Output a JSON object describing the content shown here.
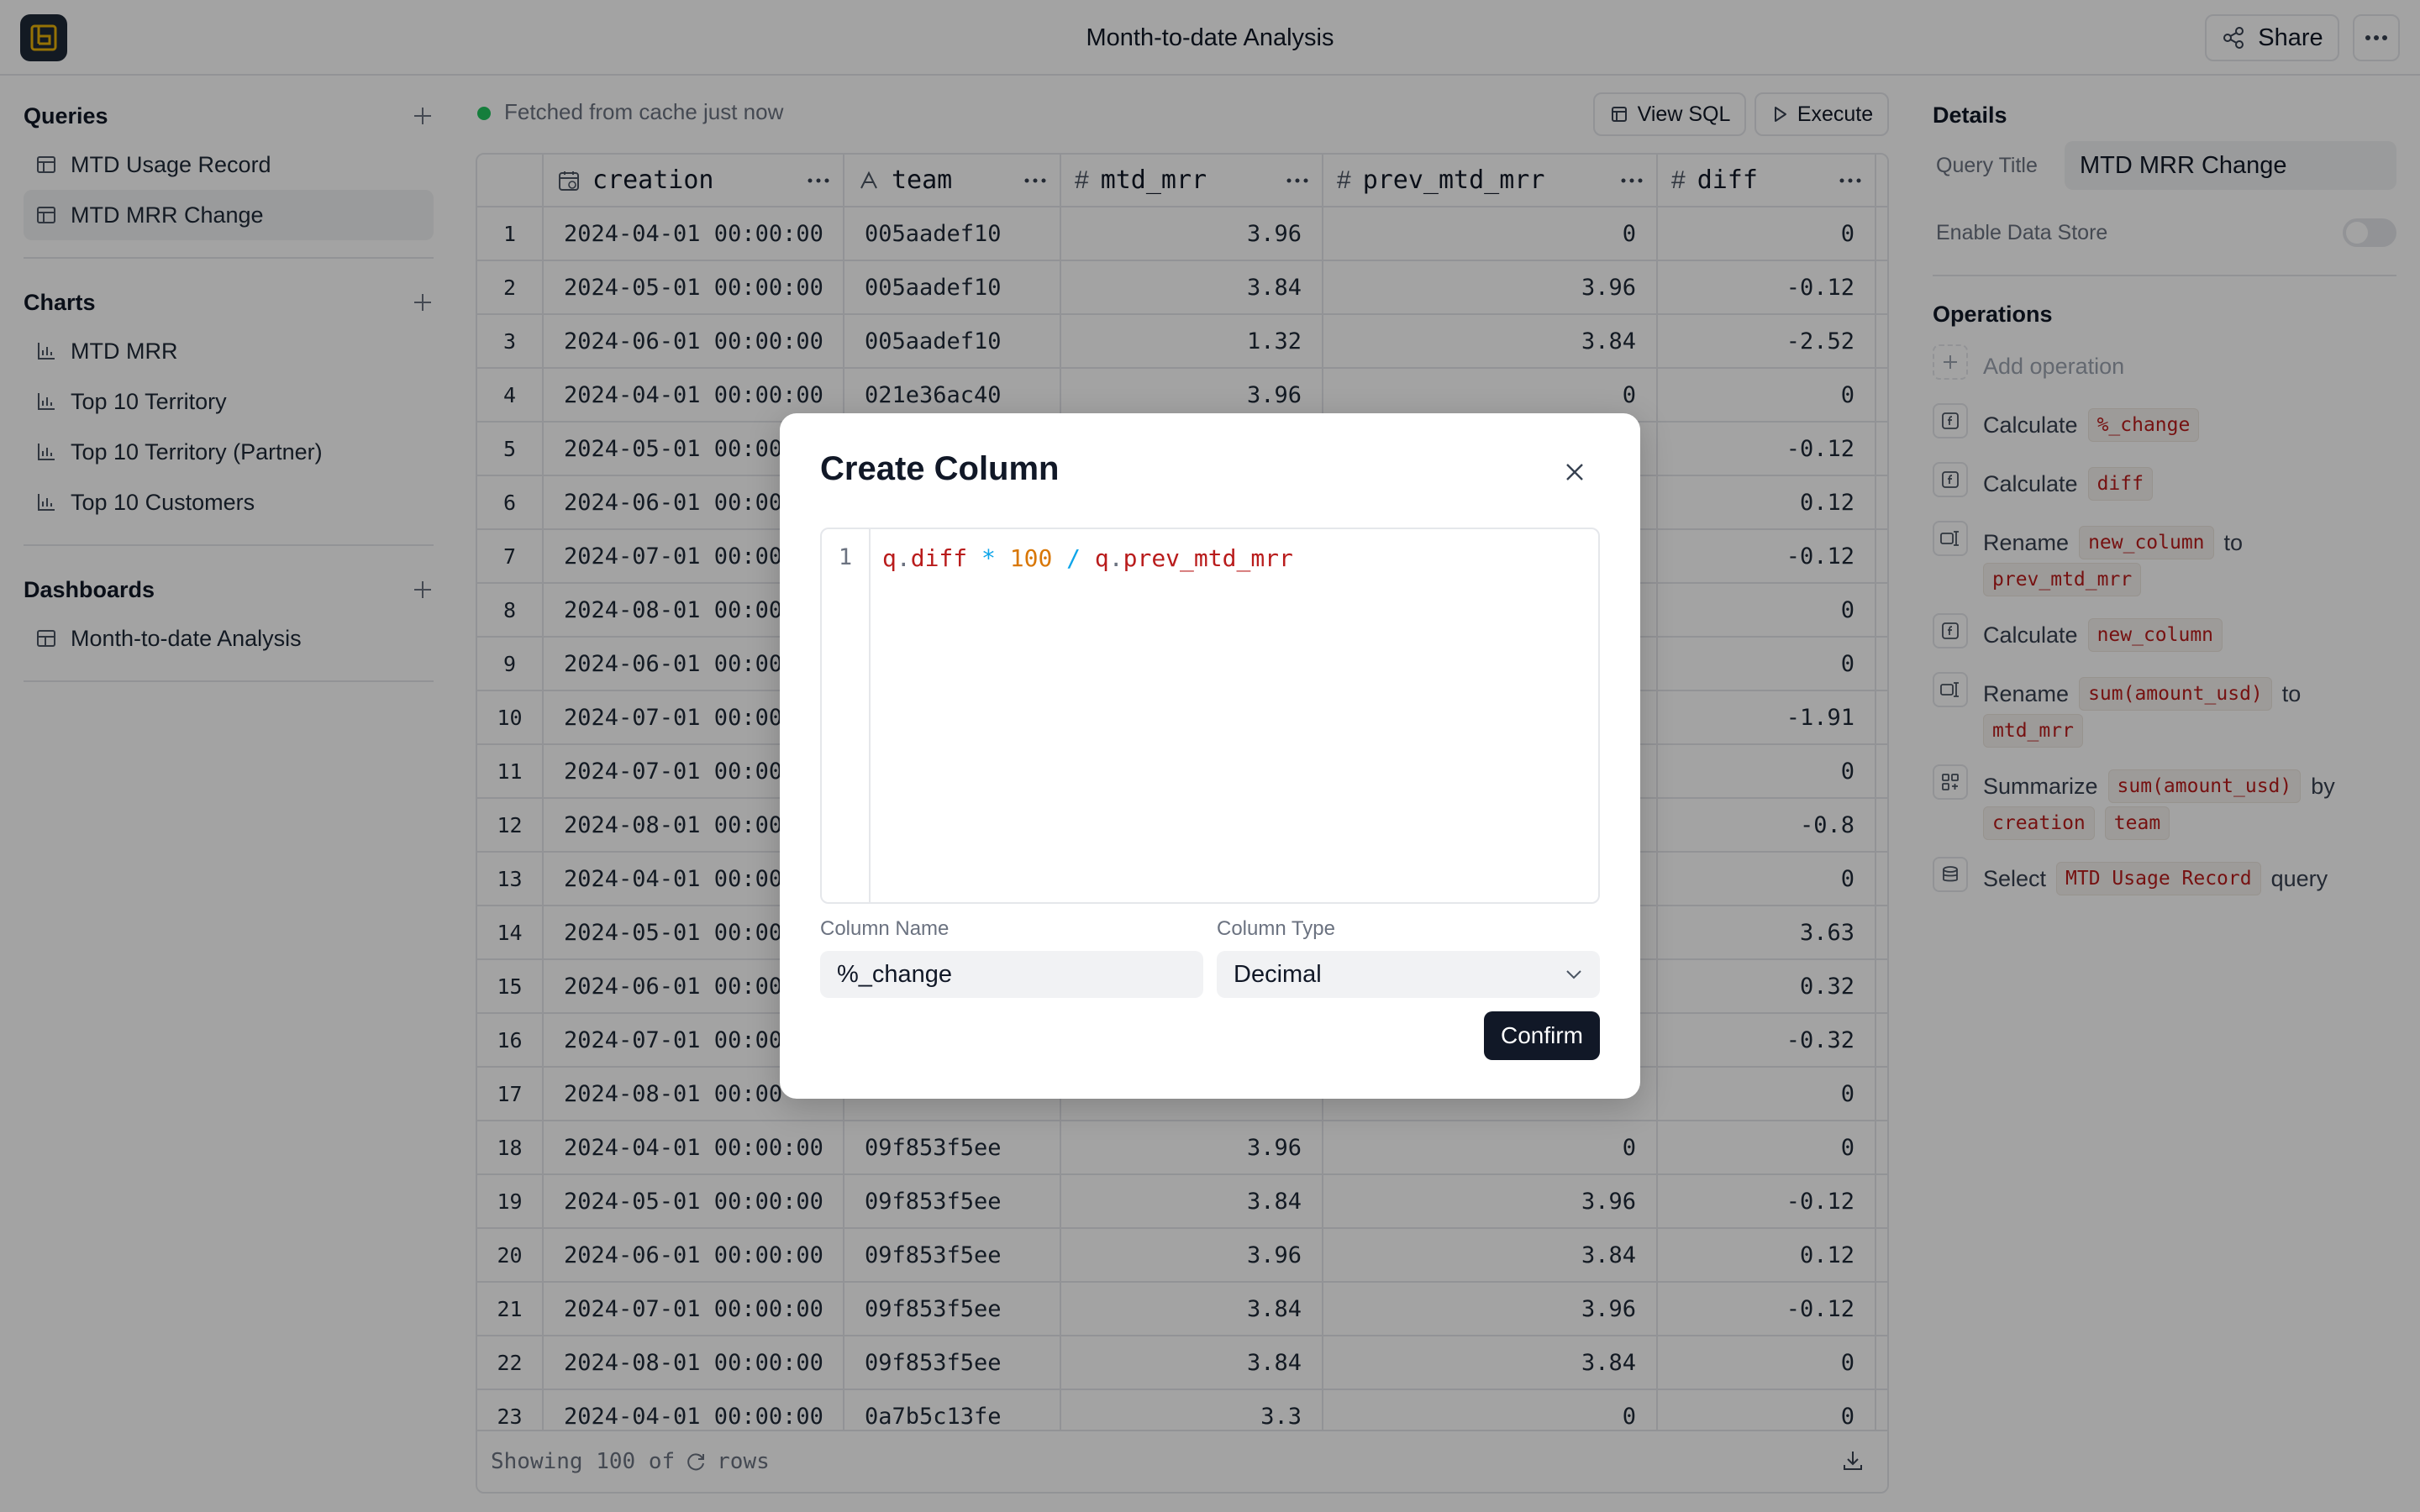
{
  "app": {
    "title": "Month-to-date Analysis",
    "share_label": "Share"
  },
  "sidebar": {
    "queries": {
      "title": "Queries",
      "items": [
        {
          "label": "MTD Usage Record"
        },
        {
          "label": "MTD MRR Change"
        }
      ]
    },
    "charts": {
      "title": "Charts",
      "items": [
        {
          "label": "MTD MRR"
        },
        {
          "label": "Top 10 Territory"
        },
        {
          "label": "Top 10 Territory (Partner)"
        },
        {
          "label": "Top 10 Customers"
        }
      ]
    },
    "dashboards": {
      "title": "Dashboards",
      "items": [
        {
          "label": "Month-to-date Analysis"
        }
      ]
    }
  },
  "toolbar": {
    "status": "Fetched from cache just now",
    "view_sql_label": "View SQL",
    "execute_label": "Execute"
  },
  "table": {
    "columns": [
      "creation",
      "team",
      "mtd_mrr",
      "prev_mtd_mrr",
      "diff"
    ],
    "rows": [
      {
        "idx": "1",
        "creation": "2024-04-01 00:00:00",
        "team": "005aadef10",
        "mtd_mrr": "3.96",
        "prev_mtd_mrr": "0",
        "diff": "0"
      },
      {
        "idx": "2",
        "creation": "2024-05-01 00:00:00",
        "team": "005aadef10",
        "mtd_mrr": "3.84",
        "prev_mtd_mrr": "3.96",
        "diff": "-0.12"
      },
      {
        "idx": "3",
        "creation": "2024-06-01 00:00:00",
        "team": "005aadef10",
        "mtd_mrr": "1.32",
        "prev_mtd_mrr": "3.84",
        "diff": "-2.52"
      },
      {
        "idx": "4",
        "creation": "2024-04-01 00:00:00",
        "team": "021e36ac40",
        "mtd_mrr": "3.96",
        "prev_mtd_mrr": "0",
        "diff": "0"
      },
      {
        "idx": "5",
        "creation": "2024-05-01 00:00",
        "team": "",
        "mtd_mrr": "",
        "prev_mtd_mrr": "",
        "diff": "-0.12"
      },
      {
        "idx": "6",
        "creation": "2024-06-01 00:00",
        "team": "",
        "mtd_mrr": "",
        "prev_mtd_mrr": "",
        "diff": "0.12"
      },
      {
        "idx": "7",
        "creation": "2024-07-01 00:00",
        "team": "",
        "mtd_mrr": "",
        "prev_mtd_mrr": "",
        "diff": "-0.12"
      },
      {
        "idx": "8",
        "creation": "2024-08-01 00:00",
        "team": "",
        "mtd_mrr": "",
        "prev_mtd_mrr": "",
        "diff": "0"
      },
      {
        "idx": "9",
        "creation": "2024-06-01 00:00",
        "team": "",
        "mtd_mrr": "",
        "prev_mtd_mrr": "",
        "diff": "0"
      },
      {
        "idx": "10",
        "creation": "2024-07-01 00:00",
        "team": "",
        "mtd_mrr": "",
        "prev_mtd_mrr": "",
        "diff": "-1.91"
      },
      {
        "idx": "11",
        "creation": "2024-07-01 00:00",
        "team": "",
        "mtd_mrr": "",
        "prev_mtd_mrr": "",
        "diff": "0"
      },
      {
        "idx": "12",
        "creation": "2024-08-01 00:00",
        "team": "",
        "mtd_mrr": "",
        "prev_mtd_mrr": "",
        "diff": "-0.8"
      },
      {
        "idx": "13",
        "creation": "2024-04-01 00:00",
        "team": "",
        "mtd_mrr": "",
        "prev_mtd_mrr": "",
        "diff": "0"
      },
      {
        "idx": "14",
        "creation": "2024-05-01 00:00",
        "team": "",
        "mtd_mrr": "",
        "prev_mtd_mrr": "",
        "diff": "3.63"
      },
      {
        "idx": "15",
        "creation": "2024-06-01 00:00",
        "team": "",
        "mtd_mrr": "",
        "prev_mtd_mrr": "",
        "diff": "0.32"
      },
      {
        "idx": "16",
        "creation": "2024-07-01 00:00",
        "team": "",
        "mtd_mrr": "",
        "prev_mtd_mrr": "",
        "diff": "-0.32"
      },
      {
        "idx": "17",
        "creation": "2024-08-01 00:00",
        "team": "",
        "mtd_mrr": "",
        "prev_mtd_mrr": "",
        "diff": "0"
      },
      {
        "idx": "18",
        "creation": "2024-04-01 00:00:00",
        "team": "09f853f5ee",
        "mtd_mrr": "3.96",
        "prev_mtd_mrr": "0",
        "diff": "0"
      },
      {
        "idx": "19",
        "creation": "2024-05-01 00:00:00",
        "team": "09f853f5ee",
        "mtd_mrr": "3.84",
        "prev_mtd_mrr": "3.96",
        "diff": "-0.12"
      },
      {
        "idx": "20",
        "creation": "2024-06-01 00:00:00",
        "team": "09f853f5ee",
        "mtd_mrr": "3.96",
        "prev_mtd_mrr": "3.84",
        "diff": "0.12"
      },
      {
        "idx": "21",
        "creation": "2024-07-01 00:00:00",
        "team": "09f853f5ee",
        "mtd_mrr": "3.84",
        "prev_mtd_mrr": "3.96",
        "diff": "-0.12"
      },
      {
        "idx": "22",
        "creation": "2024-08-01 00:00:00",
        "team": "09f853f5ee",
        "mtd_mrr": "3.84",
        "prev_mtd_mrr": "3.84",
        "diff": "0"
      },
      {
        "idx": "23",
        "creation": "2024-04-01 00:00:00",
        "team": "0a7b5c13fe",
        "mtd_mrr": "3.3",
        "prev_mtd_mrr": "0",
        "diff": "0"
      }
    ],
    "footer_prefix": "Showing 100 of",
    "footer_suffix": "rows"
  },
  "details": {
    "title": "Details",
    "query_title_label": "Query Title",
    "query_title_value": "MTD MRR Change",
    "data_store_label": "Enable Data Store",
    "data_store_enabled": false,
    "operations_title": "Operations",
    "add_operation_label": "Add operation",
    "operations": [
      {
        "icon": "function-icon",
        "parts": [
          {
            "t": "Calculate"
          },
          {
            "tag": "%_change"
          }
        ]
      },
      {
        "icon": "function-icon",
        "parts": [
          {
            "t": "Calculate"
          },
          {
            "tag": "diff"
          }
        ]
      },
      {
        "icon": "rename-icon",
        "parts": [
          {
            "t": "Rename"
          },
          {
            "tag": "new_column"
          },
          {
            "t": "to"
          },
          {
            "tag": "prev_mtd_mrr"
          }
        ]
      },
      {
        "icon": "function-icon",
        "parts": [
          {
            "t": "Calculate"
          },
          {
            "tag": "new_column"
          }
        ]
      },
      {
        "icon": "rename-icon",
        "parts": [
          {
            "t": "Rename"
          },
          {
            "tag": "sum(amount_usd)"
          },
          {
            "t": "to"
          },
          {
            "tag": "mtd_mrr"
          }
        ]
      },
      {
        "icon": "summarize-icon",
        "parts": [
          {
            "t": "Summarize"
          },
          {
            "tag": "sum(amount_usd)"
          },
          {
            "t": "by"
          },
          {
            "tag": "creation"
          },
          {
            "tag": "team"
          }
        ]
      },
      {
        "icon": "database-icon",
        "parts": [
          {
            "t": "Select"
          },
          {
            "tag": "MTD Usage Record"
          },
          {
            "t": "query"
          }
        ]
      }
    ]
  },
  "modal": {
    "title": "Create Column",
    "line_number": "1",
    "code_tokens": [
      {
        "text": "q",
        "k": "id"
      },
      {
        "text": ".",
        "k": "dot"
      },
      {
        "text": "diff",
        "k": "id"
      },
      {
        "text": " ",
        "k": "sp"
      },
      {
        "text": "*",
        "k": "op"
      },
      {
        "text": " ",
        "k": "sp"
      },
      {
        "text": "100",
        "k": "num"
      },
      {
        "text": " ",
        "k": "sp"
      },
      {
        "text": "/",
        "k": "op"
      },
      {
        "text": " ",
        "k": "sp"
      },
      {
        "text": "q",
        "k": "id"
      },
      {
        "text": ".",
        "k": "dot"
      },
      {
        "text": "prev_mtd_mrr",
        "k": "id"
      }
    ],
    "column_name_label": "Column Name",
    "column_name_value": "%_change",
    "column_type_label": "Column Type",
    "column_type_value": "Decimal",
    "confirm_label": "Confirm"
  },
  "colors": {
    "tag_text": "#b91c1c",
    "status_dot": "#22c55e",
    "confirm_bg": "#111827"
  }
}
